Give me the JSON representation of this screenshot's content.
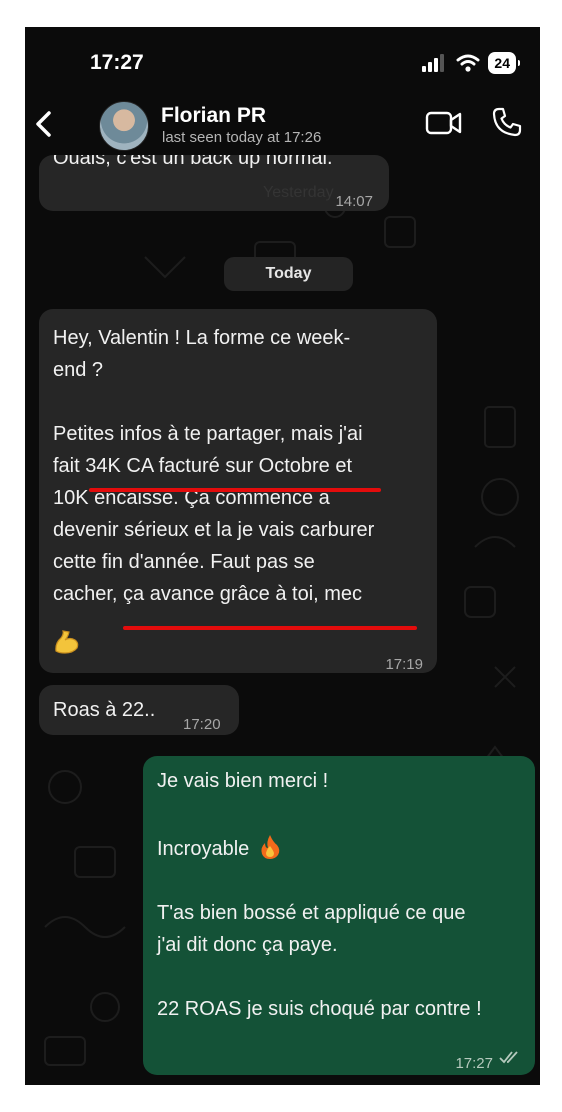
{
  "status_bar": {
    "time": "17:27",
    "battery": "24"
  },
  "header": {
    "contact_name": "Florian PR",
    "last_seen": "last seen today at 17:26"
  },
  "messages": {
    "prev": {
      "text": "Ouais, c'est un back up normal.",
      "overlay": "Yesterday",
      "time": "14:07"
    },
    "date_separator": "Today",
    "m1": {
      "text": "Hey, Valentin ! La forme ce week-\nend ?\n\nPetites infos à te partager, mais j'ai\nfait 34K CA facturé sur Octobre et\n10K encaissé. Ça commence à\ndevenir sérieux et la je vais carburer\ncette fin d'année. Faut pas se\ncacher, ça avance grâce à toi, mec",
      "emoji": "flexed-biceps",
      "time": "17:19"
    },
    "m2": {
      "text": "Roas à 22..",
      "time": "17:20"
    },
    "m3": {
      "line1": "Je vais bien merci !",
      "line2": "Incroyable",
      "emoji": "fire",
      "line3": "T'as bien bossé et appliqué ce que\nj'ai dit donc ça paye.",
      "line4": "22 ROAS je suis choqué par contre !",
      "time": "17:27",
      "status": "read"
    }
  },
  "colors": {
    "incoming_bubble": "#262626",
    "outgoing_bubble": "#145237",
    "underline": "#e30c0c",
    "background": "#0b0b0b"
  }
}
